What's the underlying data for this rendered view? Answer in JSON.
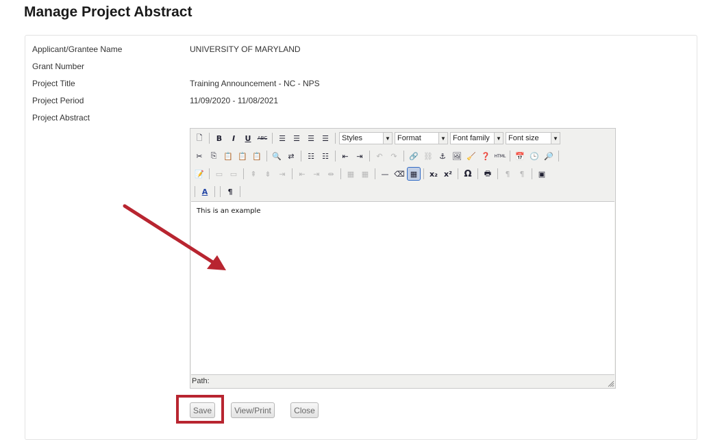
{
  "page": {
    "title": "Manage Project Abstract"
  },
  "fields": [
    {
      "label": "Applicant/Grantee Name",
      "value": "UNIVERSITY OF MARYLAND"
    },
    {
      "label": "Grant Number",
      "value": ""
    },
    {
      "label": "Project Title",
      "value": "Training Announcement - NC - NPS"
    },
    {
      "label": "Project Period",
      "value": "11/09/2020 - 11/08/2021"
    },
    {
      "label": "Project Abstract",
      "value": ""
    }
  ],
  "editor": {
    "dropdowns": {
      "styles": "Styles",
      "format": "Format",
      "font_family": "Font family",
      "font_size": "Font size"
    },
    "content": "This is an example",
    "path_label": "Path:"
  },
  "buttons": {
    "save": "Save",
    "view_print": "View/Print",
    "close": "Close"
  },
  "colors": {
    "highlight": "#b82530",
    "arrow": "#b82530"
  }
}
